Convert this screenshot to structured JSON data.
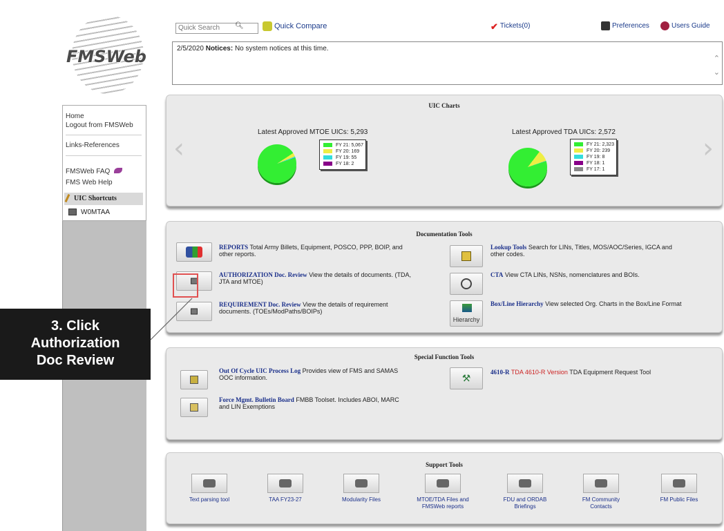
{
  "logo": {
    "text": "FMSWeb"
  },
  "nav": {
    "home": "Home",
    "logout": "Logout from FMSWeb",
    "links_references": "Links-References",
    "faq": "FMSWeb FAQ",
    "help": "FMS Web Help",
    "uic_shortcuts": "UIC Shortcuts",
    "uic_item": "W0MTAA"
  },
  "toolbar": {
    "search_placeholder": "Quick Search",
    "quick_compare": "Quick Compare",
    "tickets": "Tickets(0)",
    "preferences": "Preferences",
    "users_guide": "Users Guide"
  },
  "notices": {
    "date": "2/5/2020",
    "label": "Notices:",
    "text": "No system notices at this time."
  },
  "uic_charts": {
    "title": "UIC Charts",
    "mtoe": {
      "label": "Latest Approved MTOE UICs: 5,293",
      "legend": [
        "FY 21: 5,067",
        "FY 20: 169",
        "FY 19: 55",
        "FY 18: 2"
      ]
    },
    "tda": {
      "label": "Latest Approved TDA UICs: 2,572",
      "legend": [
        "FY 21: 2,323",
        "FY 20: 239",
        "FY 19: 8",
        "FY 18: 1",
        "FY 17: 1"
      ]
    },
    "legend_colors": [
      "#33ee33",
      "#eeee44",
      "#33dddd",
      "#880088",
      "#888888"
    ]
  },
  "chart_data": [
    {
      "type": "pie",
      "title": "Latest Approved MTOE UICs: 5,293",
      "categories": [
        "FY 21",
        "FY 20",
        "FY 19",
        "FY 18"
      ],
      "values": [
        5067,
        169,
        55,
        2
      ]
    },
    {
      "type": "pie",
      "title": "Latest Approved TDA UICs: 2,572",
      "categories": [
        "FY 21",
        "FY 20",
        "FY 19",
        "FY 18",
        "FY 17"
      ],
      "values": [
        2323,
        239,
        8,
        1,
        1
      ]
    }
  ],
  "documentation_tools": {
    "title": "Documentation Tools",
    "reports": {
      "title": "REPORTS",
      "desc1": "Total Army Billets, Equipment, POSCO, PPP, BOIP, and",
      "desc2": "other reports."
    },
    "authorization": {
      "title": "AUTHORIZATION Doc. Review",
      "desc1": "View the details of documents. (TDA,",
      "desc2": "JTA and MTOE)"
    },
    "requirement": {
      "title": "REQUIREMENT Doc. Review",
      "desc1": "View the details of requirement",
      "desc2": "documents. (TOEs/ModPaths/BOIPs)"
    },
    "lookup": {
      "title": "Lookup Tools",
      "desc1": "Search for LINs, Titles, MOS/AOC/Series, IGCA and",
      "desc2": "other codes."
    },
    "cta": {
      "title": "CTA",
      "desc1": "View CTA LINs, NSNs, nomenclatures and BOIs."
    },
    "boxline": {
      "title": "Box/Line Hierarchy",
      "desc1": "View selected Org. Charts in the Box/Line Format",
      "button": "Hierarchy"
    }
  },
  "special_tools": {
    "title": "Special Function Tools",
    "ooc": {
      "title": "Out Of Cycle UIC Process Log",
      "desc1": "Provides view of FMS and SAMAS",
      "desc2": "OOC information."
    },
    "fmbb": {
      "title": "Force Mgmt. Bulletin Board",
      "desc1": "FMBB Toolset. Includes ABOI, MARC",
      "desc2": "and LIN Exemptions"
    },
    "r4610": {
      "title": "4610-R",
      "red": "TDA 4610-R Version",
      "desc1": "TDA Equipment Request Tool"
    }
  },
  "support_tools": {
    "title": "Support Tools",
    "items": [
      {
        "l1": "Text parsing tool",
        "l2": ""
      },
      {
        "l1": "TAA FY23-27",
        "l2": ""
      },
      {
        "l1": "Modularity Files",
        "l2": ""
      },
      {
        "l1": "MTOE/TDA Files and",
        "l2": "FMSWeb reports"
      },
      {
        "l1": "FDU and ORDAB",
        "l2": "Briefings"
      },
      {
        "l1": "FM Community",
        "l2": "Contacts"
      },
      {
        "l1": "FM Public Files",
        "l2": ""
      }
    ]
  },
  "callout": {
    "line1": "3. Click",
    "line2": "Authorization",
    "line3": "Doc Review"
  }
}
